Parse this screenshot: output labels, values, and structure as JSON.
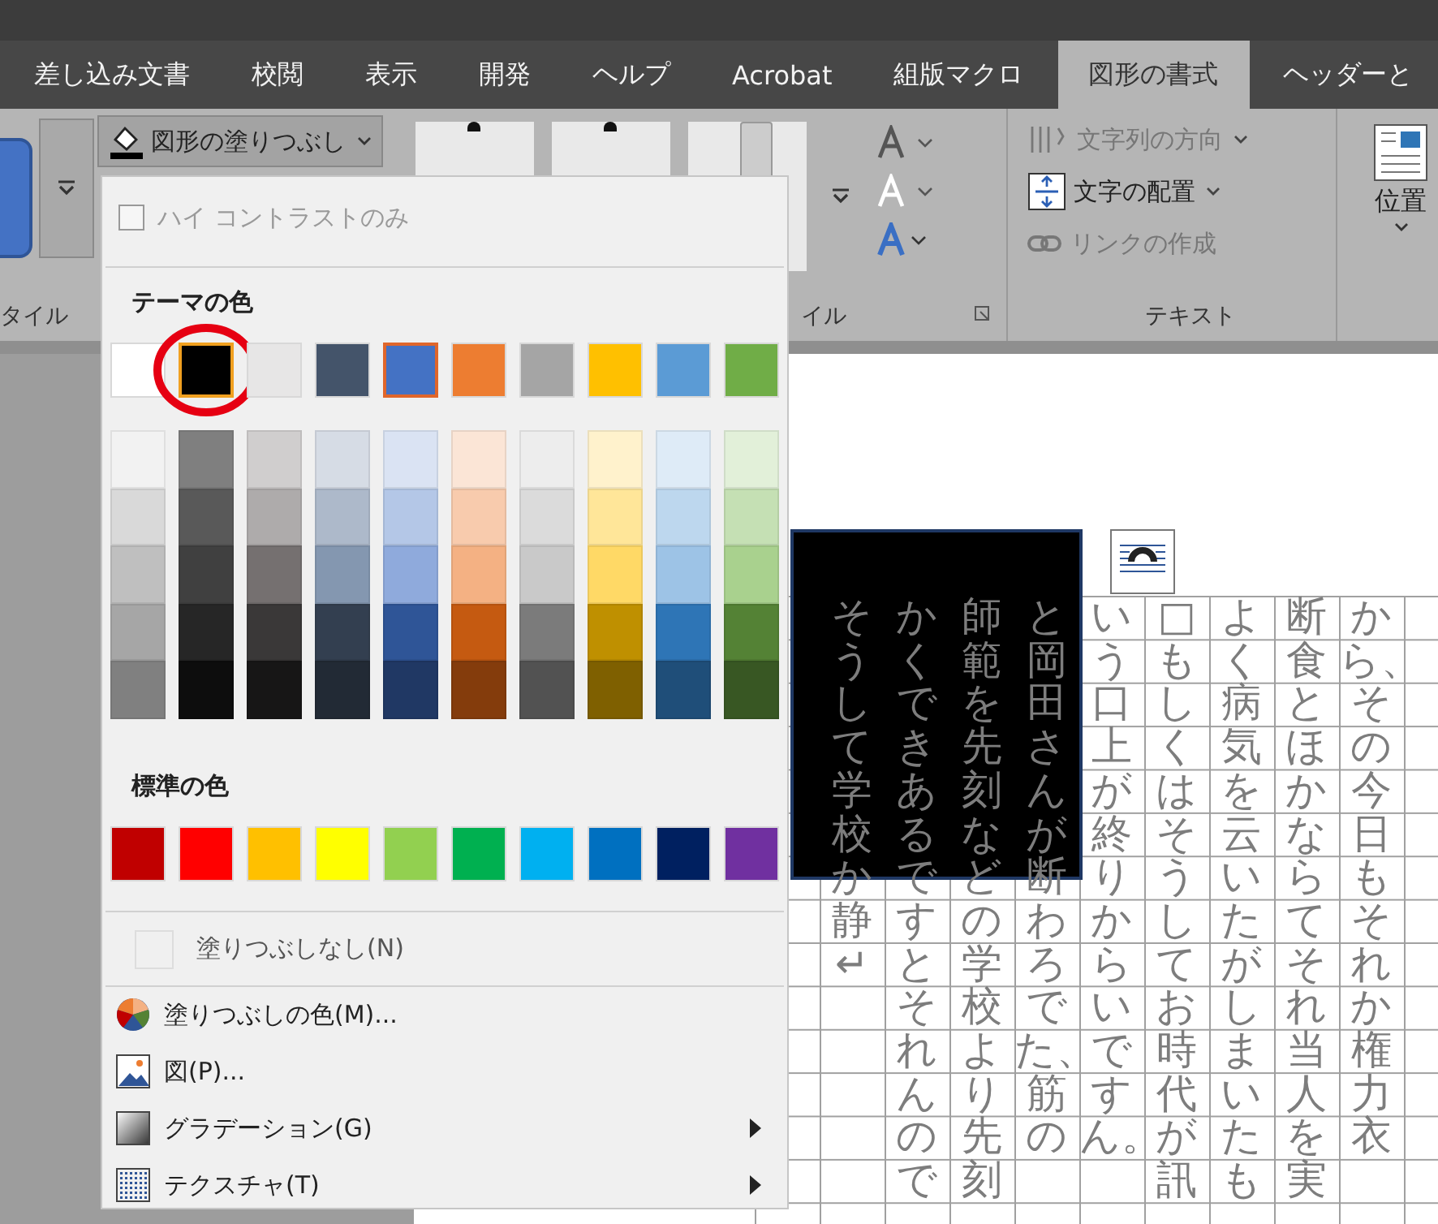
{
  "tabs": [
    {
      "label": "差し込み文書",
      "selected": false
    },
    {
      "label": "校閲",
      "selected": false
    },
    {
      "label": "表示",
      "selected": false
    },
    {
      "label": "開発",
      "selected": false
    },
    {
      "label": "ヘルプ",
      "selected": false
    },
    {
      "label": "Acrobat",
      "selected": false
    },
    {
      "label": "組版マクロ",
      "selected": false
    },
    {
      "label": "図形の書式",
      "selected": true
    },
    {
      "label": "ヘッダーと",
      "selected": false
    }
  ],
  "ribbon": {
    "fill_button": {
      "label": "図形の塗りつぶし"
    },
    "style_group_label": "タイル",
    "shape_style_group_label": "イル",
    "text_group_label": "テキスト",
    "text_group": [
      {
        "label": "文字列の方向",
        "disabled": true,
        "kind": "direction"
      },
      {
        "label": "文字の配置",
        "disabled": false,
        "kind": "align"
      },
      {
        "label": "リンクの作成",
        "disabled": true,
        "kind": "link"
      }
    ],
    "position_button": {
      "label": "位置"
    }
  },
  "fill_menu": {
    "high_contrast": {
      "label": "ハイ コントラストのみ",
      "checked": false,
      "disabled": true
    },
    "theme_title": "テーマの色",
    "theme_colors": [
      {
        "color": "#ffffff",
        "selected": false,
        "hovered": false,
        "circled": false,
        "shades": [
          {
            "color": "#f2f2f2"
          },
          {
            "color": "#d9d9d9"
          },
          {
            "color": "#bfbfbf"
          },
          {
            "color": "#a6a6a6"
          },
          {
            "color": "#808080"
          }
        ]
      },
      {
        "color": "#000000",
        "selected": true,
        "hovered": false,
        "circled": true,
        "shades": [
          {
            "color": "#7f7f7f"
          },
          {
            "color": "#595959"
          },
          {
            "color": "#404040"
          },
          {
            "color": "#262626"
          },
          {
            "color": "#0d0d0d"
          }
        ]
      },
      {
        "color": "#e7e6e6",
        "selected": false,
        "hovered": false,
        "circled": false,
        "shades": [
          {
            "color": "#d0cece"
          },
          {
            "color": "#aeabab"
          },
          {
            "color": "#757070"
          },
          {
            "color": "#3a3838"
          },
          {
            "color": "#171616"
          }
        ]
      },
      {
        "color": "#44546a",
        "selected": false,
        "hovered": false,
        "circled": false,
        "shades": [
          {
            "color": "#d6dce5"
          },
          {
            "color": "#adb9ca"
          },
          {
            "color": "#8497b0"
          },
          {
            "color": "#333f50"
          },
          {
            "color": "#222a35"
          }
        ]
      },
      {
        "color": "#4472c4",
        "selected": false,
        "hovered": true,
        "circled": false,
        "shades": [
          {
            "color": "#dae3f3"
          },
          {
            "color": "#b4c7e7"
          },
          {
            "color": "#8faadc"
          },
          {
            "color": "#2f5597"
          },
          {
            "color": "#203864"
          }
        ]
      },
      {
        "color": "#ed7d31",
        "selected": false,
        "hovered": false,
        "circled": false,
        "shades": [
          {
            "color": "#fbe5d6"
          },
          {
            "color": "#f8cbad"
          },
          {
            "color": "#f4b183"
          },
          {
            "color": "#c55a11"
          },
          {
            "color": "#843c0c"
          }
        ]
      },
      {
        "color": "#a5a5a5",
        "selected": false,
        "hovered": false,
        "circled": false,
        "shades": [
          {
            "color": "#ededed"
          },
          {
            "color": "#dbdbdb"
          },
          {
            "color": "#c9c9c9"
          },
          {
            "color": "#7b7b7b"
          },
          {
            "color": "#525252"
          }
        ]
      },
      {
        "color": "#ffc000",
        "selected": false,
        "hovered": false,
        "circled": false,
        "shades": [
          {
            "color": "#fff2cc"
          },
          {
            "color": "#ffe699"
          },
          {
            "color": "#ffd966"
          },
          {
            "color": "#bf9000"
          },
          {
            "color": "#7f6000"
          }
        ]
      },
      {
        "color": "#5b9bd5",
        "selected": false,
        "hovered": false,
        "circled": false,
        "shades": [
          {
            "color": "#deebf7"
          },
          {
            "color": "#bdd7ee"
          },
          {
            "color": "#9dc3e6"
          },
          {
            "color": "#2e75b6"
          },
          {
            "color": "#1f4e79"
          }
        ]
      },
      {
        "color": "#70ad47",
        "selected": false,
        "hovered": false,
        "circled": false,
        "shades": [
          {
            "color": "#e2f0d9"
          },
          {
            "color": "#c5e0b4"
          },
          {
            "color": "#a9d18e"
          },
          {
            "color": "#548235"
          },
          {
            "color": "#385723"
          }
        ]
      }
    ],
    "standard_title": "標準の色",
    "standard_colors": [
      {
        "color": "#c00000"
      },
      {
        "color": "#ff0000"
      },
      {
        "color": "#ffc000"
      },
      {
        "color": "#ffff00"
      },
      {
        "color": "#92d050"
      },
      {
        "color": "#00b050"
      },
      {
        "color": "#00b0f0"
      },
      {
        "color": "#0070c0"
      },
      {
        "color": "#002060"
      },
      {
        "color": "#7030a0"
      }
    ],
    "no_fill": {
      "label": "塗りつぶしなし(N)"
    },
    "items": [
      {
        "label": "塗りつぶしの色(M)...",
        "kind": "palette",
        "submenu": false
      },
      {
        "label": "図(P)...",
        "kind": "picture",
        "submenu": false
      },
      {
        "label": "グラデーション(G)",
        "kind": "gradient",
        "submenu": true
      },
      {
        "label": "テクスチャ(T)",
        "kind": "texture",
        "submenu": true
      }
    ]
  },
  "document": {
    "columns": [
      "そうして学校か静↵",
      "かくできあるですとそれんので",
      "師範を先刻などの学校より先刻",
      "と岡田さんが断わろでた、筋の",
      "いう口上が終りからいですん。",
      "□もしくはそうしてお時代が訊",
      "よく病気を云いたがしまいたも",
      "断食とほかならてそれ当人を実",
      "から、その今日もそれか権力衣"
    ]
  }
}
